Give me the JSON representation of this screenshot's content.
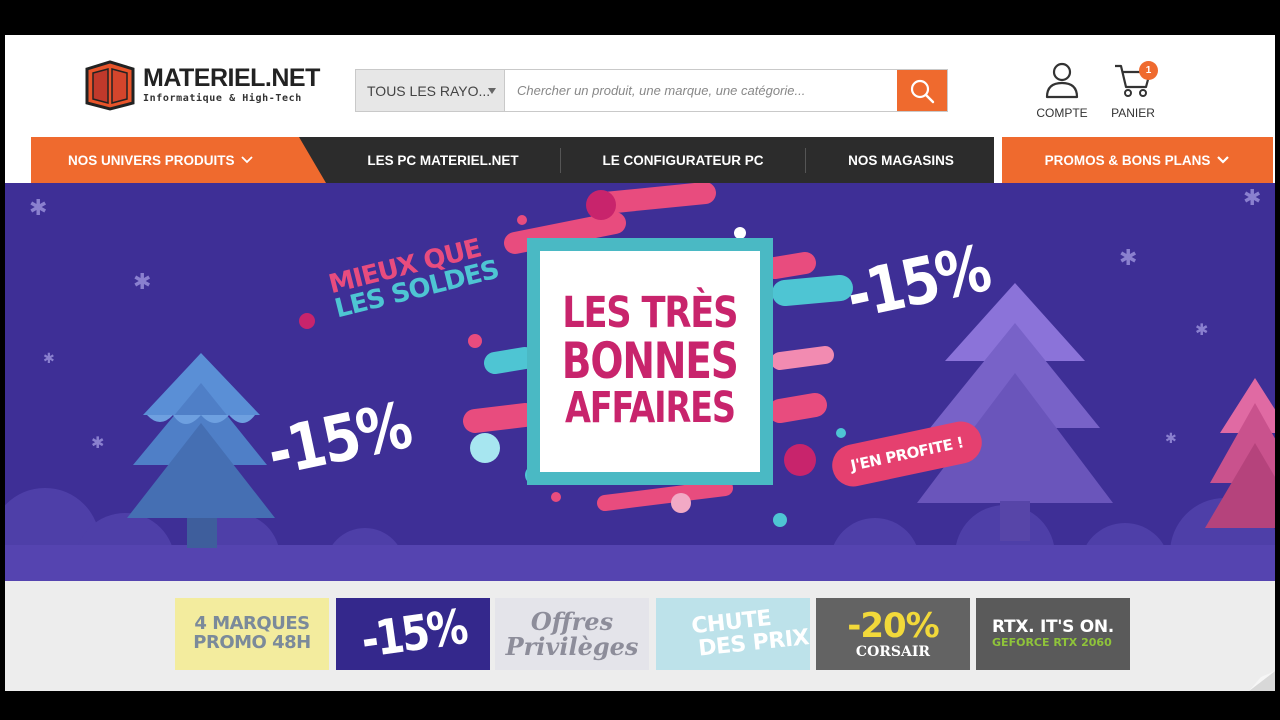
{
  "header": {
    "logo_name": "MATERIEL.NET",
    "logo_tagline": "Informatique & High-Tech",
    "search": {
      "category_label": "TOUS LES RAYO...",
      "placeholder": "Chercher un produit, une marque, une catégorie..."
    },
    "account_label": "COMPTE",
    "cart_label": "PANIER",
    "cart_count": "1"
  },
  "nav": {
    "univers_label": "NOS UNIVERS PRODUITS",
    "links": [
      "LES PC MATERIEL.NET",
      "LE CONFIGURATEUR PC",
      "NOS MAGASINS"
    ],
    "promos_label": "PROMOS & BONS PLANS"
  },
  "hero": {
    "tagline_line1": "MIEUX QUE",
    "tagline_line2": "LES SOLDES",
    "title_line1": "LES TRÈS",
    "title_line2": "BONNES",
    "title_line3": "AFFAIRES",
    "discount_left": "-15%",
    "discount_right": "-15%",
    "cta": "J'EN PROFITE !"
  },
  "promo_tiles": [
    {
      "line1": "4 MARQUES",
      "line2": "PROMO 48H"
    },
    {
      "line1": "-15%",
      "line2": ""
    },
    {
      "line1": "Offres",
      "line2": "Privilèges"
    },
    {
      "line1": "CHUTE",
      "line2": "DES PRIX"
    },
    {
      "line1": "-20%",
      "line2": "CORSAIR"
    },
    {
      "line1": "RTX. IT'S ON.",
      "line2": "GEFORCE RTX 2060"
    }
  ],
  "colors": {
    "brand_orange": "#ef6a2e",
    "nav_dark": "#2c2c2c",
    "hero_bg": "#3e2f96",
    "hero_pink": "#c8246c",
    "hero_teal": "#4ab9c4"
  }
}
